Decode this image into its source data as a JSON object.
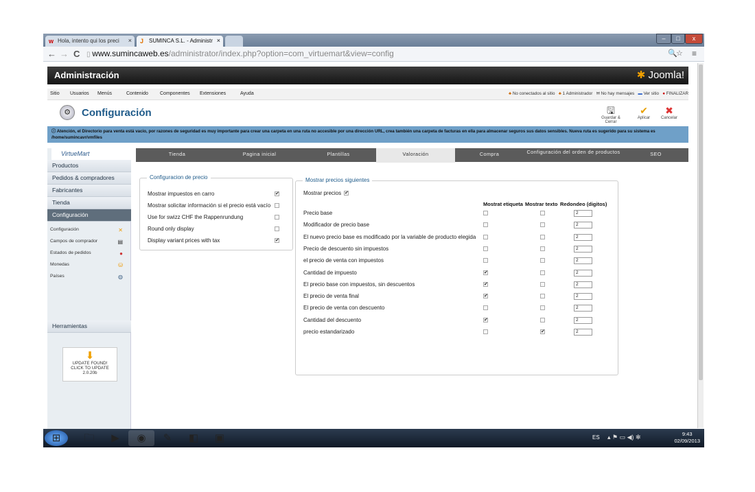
{
  "browser": {
    "tabs": [
      {
        "label": "Hola, intento qui los preci",
        "icon": "w"
      },
      {
        "label": "SUMINCA S.L. - Administr",
        "icon": "J"
      }
    ],
    "url_domain": "www.sumincaweb.es",
    "url_path": "/administrator/index.php?option=com_virtuemart&view=config",
    "nav": {
      "back": "←",
      "forward": "→",
      "reload": "C"
    }
  },
  "header": {
    "title": "Administración",
    "logo": "Joomla!"
  },
  "menu": {
    "items": [
      "Sitio",
      "Usuarios",
      "Menús",
      "Contenido",
      "Componentes",
      "Extensiones",
      "Ayuda"
    ],
    "right": {
      "visitors": "No conectados al sitio",
      "admins": "1 Administrador",
      "messages": "No hay mensajes",
      "view_site": "Ver sitio",
      "logout": "FINALIZAR"
    }
  },
  "toolbar": {
    "title": "Configuración",
    "save_close": "Guardar & Cerrar",
    "apply": "Aplicar",
    "cancel": "Cancelar"
  },
  "warning": "Atención, el Directorio para venta está vacio, por razones de seguridad es muy importante para crear una carpeta en una ruta no accesible por una dirección URL, crea también una carpeta de facturas en ella para almacenar seguros sus datos sensibles. Nueva ruta es sugerido para su sistema es /home/sumincavr/vmfiles",
  "sidebar": {
    "logo": "VirtueMart",
    "items": [
      "Productos",
      "Pedidos & compradores",
      "Fabricantes",
      "Tienda",
      "Configuración"
    ],
    "subitems": [
      "Configuración",
      "Campos de comprador",
      "Estados de pedidos",
      "Monedas",
      "Países"
    ],
    "tools": "Herramientas",
    "update": {
      "line1": "UPDATE FOUND!",
      "line2": "CLICK TO UPDATE",
      "version": "2.0.20b"
    }
  },
  "tabs": [
    "Tienda",
    "Pagina inicial",
    "Plantillas",
    "Valoración",
    "Compra",
    "Configuración del orden de productos",
    "SEO"
  ],
  "price_config": {
    "legend": "Configuracion de precio",
    "rows": [
      {
        "label": "Mostrar impuestos en carro",
        "checked": true
      },
      {
        "label": "Mostrar solicitar información si el precio está vacío",
        "checked": false
      },
      {
        "label": "Use for swizz CHF the Rappenrundung",
        "checked": false
      },
      {
        "label": "Round only display",
        "checked": false
      },
      {
        "label": "Display variant prices with tax",
        "checked": true
      }
    ]
  },
  "show_prices": {
    "legend": "Mostrar precios siguientes",
    "toggle_label": "Mostrar precios",
    "toggle_checked": true,
    "columns": [
      "Mostrat etiqueta",
      "Mostrar texto",
      "Redondeo (digitos)"
    ],
    "rows": [
      {
        "label": "Precio base",
        "etiqueta": false,
        "texto": false,
        "digits": "2"
      },
      {
        "label": "Modificador de precio base",
        "etiqueta": false,
        "texto": false,
        "digits": "2"
      },
      {
        "label": "El nuevo precio base es modificado por la variable de producto elegida",
        "etiqueta": false,
        "texto": false,
        "digits": "2"
      },
      {
        "label": "Precio de descuento sin impuestos",
        "etiqueta": false,
        "texto": false,
        "digits": "2"
      },
      {
        "label": "el precio de venta con impuestos",
        "etiqueta": false,
        "texto": false,
        "digits": "2"
      },
      {
        "label": "Cantidad de impuesto",
        "etiqueta": true,
        "texto": false,
        "digits": "2"
      },
      {
        "label": "El precio base con impuestos, sin descuentos",
        "etiqueta": true,
        "texto": false,
        "digits": "2"
      },
      {
        "label": "El precio de venta final",
        "etiqueta": true,
        "texto": false,
        "digits": "2"
      },
      {
        "label": "El precio de venta con descuento",
        "etiqueta": false,
        "texto": false,
        "digits": "2"
      },
      {
        "label": "Cantidad del descuento",
        "etiqueta": true,
        "texto": false,
        "digits": "2"
      },
      {
        "label": "precio estandarizado",
        "etiqueta": false,
        "texto": true,
        "digits": "2"
      }
    ]
  },
  "taskbar": {
    "lang": "ES",
    "time": "9:43",
    "date": "02/09/2013"
  }
}
